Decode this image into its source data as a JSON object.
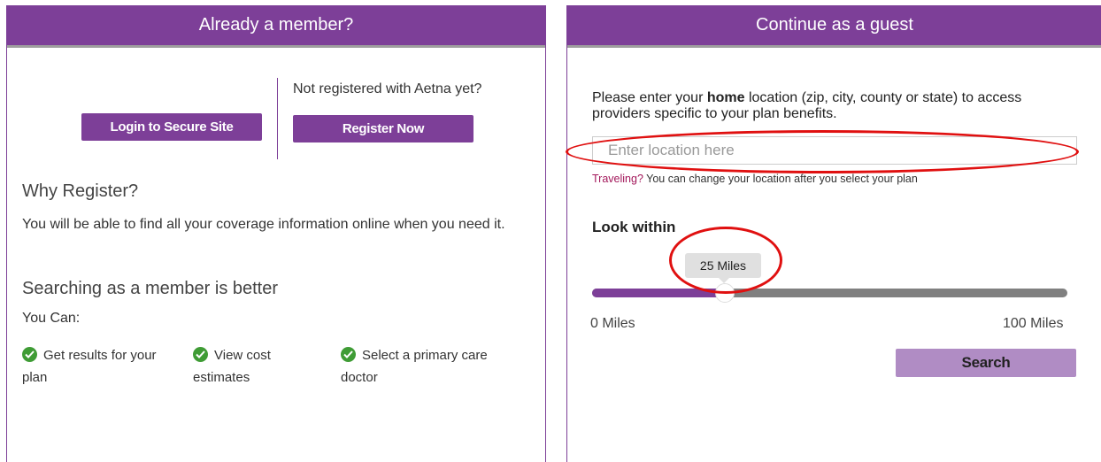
{
  "member_panel": {
    "header": "Already a member?",
    "login_label": "Login to Secure Site",
    "not_registered_text": "Not registered with Aetna yet?",
    "register_label": "Register Now",
    "why_heading": "Why Register?",
    "why_text": "You will be able to find all your coverage information online when you need it.",
    "better_heading": "Searching as a member is better",
    "you_can": "You Can:",
    "benefits": [
      {
        "label": "Get results for your plan",
        "icon": "check-circle-icon"
      },
      {
        "label": "View cost estimates",
        "icon": "check-circle-icon"
      },
      {
        "label": "Select a primary care doctor",
        "icon": "check-circle-icon"
      }
    ]
  },
  "guest_panel": {
    "header": "Continue as a guest",
    "instruction_before": "Please enter your ",
    "instruction_bold": "home",
    "instruction_after": " location (zip, city, county or state) to access providers specific to your plan benefits.",
    "location_placeholder": "Enter location here",
    "traveling_link": "Traveling?",
    "traveling_text": " You can change your location after you select your plan",
    "look_within": "Look within",
    "slider": {
      "value_label": "25 Miles",
      "value": 25,
      "min": 0,
      "max": 100,
      "min_label": "0 Miles",
      "max_label": "100 Miles"
    },
    "search_label": "Search"
  },
  "colors": {
    "brand_purple": "#7d3f98",
    "search_button": "#b08cc4",
    "check_green": "#3f9c35",
    "link_magenta": "#a3185b",
    "annotation_red": "#e01010"
  }
}
